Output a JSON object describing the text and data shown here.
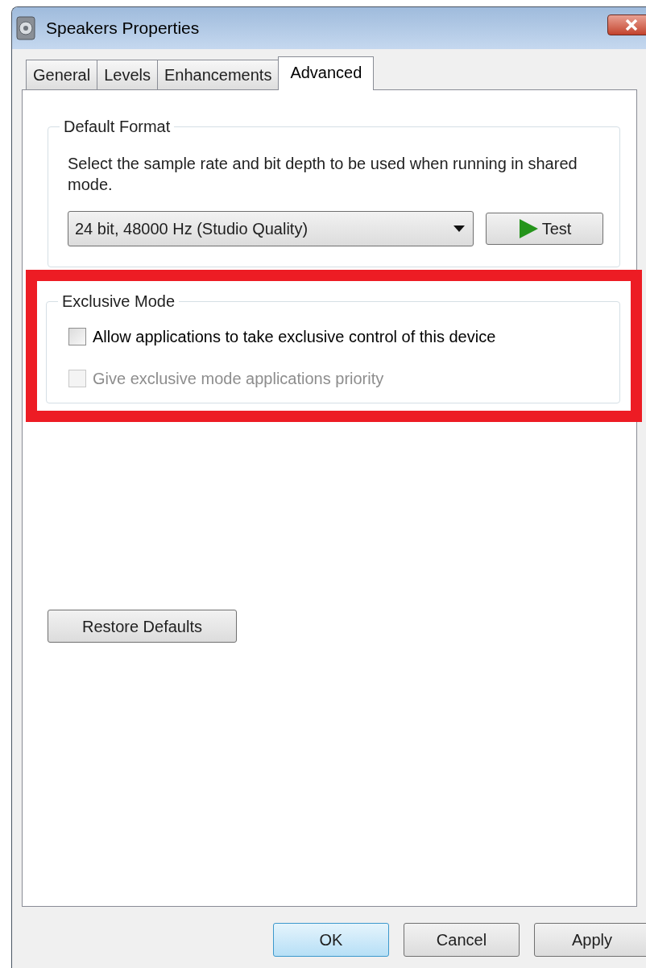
{
  "window": {
    "title": "Speakers Properties"
  },
  "tabs": [
    {
      "label": "General",
      "selected": false
    },
    {
      "label": "Levels",
      "selected": false
    },
    {
      "label": "Enhancements",
      "selected": false
    },
    {
      "label": "Advanced",
      "selected": true
    }
  ],
  "default_format": {
    "title": "Default Format",
    "description": "Select the sample rate and bit depth to be used when running in shared mode.",
    "format_dropdown": {
      "value": "24 bit, 48000 Hz (Studio Quality)"
    },
    "test_button": {
      "label": "Test"
    }
  },
  "exclusive_mode": {
    "title": "Exclusive Mode",
    "highlighted": true,
    "options": [
      {
        "label": "Allow applications to take exclusive control of this device",
        "checked": false,
        "disabled": false
      },
      {
        "label": "Give exclusive mode applications priority",
        "checked": false,
        "disabled": true
      }
    ]
  },
  "restore_button": {
    "label": "Restore Defaults"
  },
  "buttons": [
    {
      "label": "OK",
      "kind": "default"
    },
    {
      "label": "Cancel",
      "kind": "normal"
    },
    {
      "label": "Apply",
      "kind": "normal"
    }
  ]
}
